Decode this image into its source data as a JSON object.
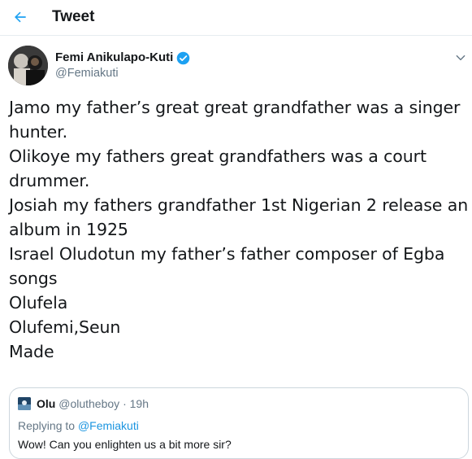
{
  "header": {
    "title": "Tweet",
    "back_icon": "arrow-left-icon"
  },
  "colors": {
    "accent": "#1da1f2",
    "text": "#14171a",
    "muted": "#657786",
    "border": "#ccd6dd"
  },
  "tweet": {
    "author_name": "Femi Anikulapo-Kuti",
    "author_handle": "@Femiakuti",
    "verified_icon": "verified-badge-icon",
    "menu_icon": "chevron-down-icon",
    "lines": [
      "Jamo my father’s great great grandfather was a singer",
      "hunter.",
      "Olikoye my fathers great grandfathers was a court",
      "drummer.",
      "Josiah my fathers grandfather 1st Nigerian 2 release an",
      "album in 1925",
      "Israel Oludotun my father’s father composer of Egba",
      "songs",
      "Olufela",
      "Olufemi,Seun",
      "Made"
    ]
  },
  "quoted": {
    "name": "Olu",
    "handle": "@olutheboy",
    "separator": "·",
    "time": "19h",
    "reply_prefix": "Replying to",
    "reply_to": "@Femiakuti",
    "text": "Wow! Can you enlighten us a bit more sir?"
  }
}
